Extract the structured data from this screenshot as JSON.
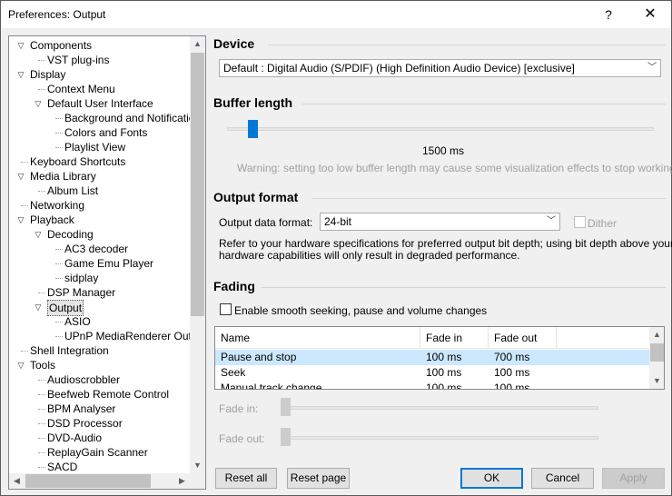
{
  "window": {
    "title": "Preferences: Output",
    "help_glyph": "?",
    "close_glyph": "✕"
  },
  "tree": {
    "items": [
      {
        "label": "Components",
        "expanded": true
      },
      {
        "label": "VST plug-ins"
      },
      {
        "label": "Display",
        "expanded": true
      },
      {
        "label": "Context Menu"
      },
      {
        "label": "Default User Interface",
        "expanded": true
      },
      {
        "label": "Background and Notifications"
      },
      {
        "label": "Colors and Fonts"
      },
      {
        "label": "Playlist View"
      },
      {
        "label": "Keyboard Shortcuts"
      },
      {
        "label": "Media Library",
        "expanded": true
      },
      {
        "label": "Album List"
      },
      {
        "label": "Networking"
      },
      {
        "label": "Playback",
        "expanded": true
      },
      {
        "label": "Decoding",
        "expanded": true
      },
      {
        "label": "AC3 decoder"
      },
      {
        "label": "Game Emu Player"
      },
      {
        "label": "sidplay"
      },
      {
        "label": "DSP Manager"
      },
      {
        "label": "Output",
        "expanded": true,
        "selected": true
      },
      {
        "label": "ASIO"
      },
      {
        "label": "UPnP MediaRenderer Output"
      },
      {
        "label": "Shell Integration"
      },
      {
        "label": "Tools",
        "expanded": true
      },
      {
        "label": "Audioscrobbler"
      },
      {
        "label": "Beefweb Remote Control"
      },
      {
        "label": "BPM Analyser"
      },
      {
        "label": "DSD Processor"
      },
      {
        "label": "DVD-Audio"
      },
      {
        "label": "ReplayGain Scanner"
      },
      {
        "label": "SACD"
      }
    ]
  },
  "device": {
    "heading": "Device",
    "selected": "Default : Digital Audio (S/PDIF) (High Definition Audio Device) [exclusive]"
  },
  "buffer": {
    "heading": "Buffer length",
    "value_label": "1500 ms",
    "position_fraction": 0.06,
    "warning": "Warning: setting too low buffer length may cause some visualization effects to stop working."
  },
  "output_format": {
    "heading": "Output format",
    "label": "Output data format:",
    "selected": "24-bit",
    "dither_label": "Dither",
    "note_line1": "Refer to your hardware specifications for preferred output bit depth; using bit depth above your",
    "note_line2": "hardware capabilities will only result in degraded performance."
  },
  "fading": {
    "heading": "Fading",
    "enable_label": "Enable smooth seeking, pause and volume changes",
    "columns": [
      "Name",
      "Fade in",
      "Fade out"
    ],
    "rows": [
      {
        "name": "Pause and stop",
        "fade_in": "100 ms",
        "fade_out": "700 ms"
      },
      {
        "name": "Seek",
        "fade_in": "100 ms",
        "fade_out": "100 ms"
      },
      {
        "name": "Manual track change",
        "fade_in": "100 ms",
        "fade_out": "100 ms"
      }
    ],
    "fade_in_label": "Fade in:",
    "fade_out_label": "Fade out:"
  },
  "buttons": {
    "reset_all": "Reset all",
    "reset_page": "Reset page",
    "ok": "OK",
    "cancel": "Cancel",
    "apply": "Apply"
  },
  "colors": {
    "accent": "#0078d7",
    "selection": "#cce8ff"
  }
}
